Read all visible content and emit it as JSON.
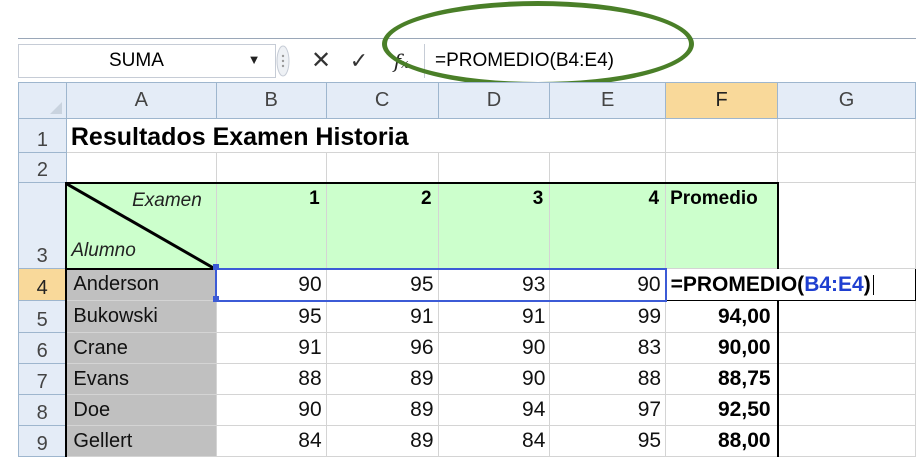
{
  "formula_bar": {
    "name_box": "SUMA",
    "formula": "=PROMEDIO(B4:E4)",
    "fx_label": "fx"
  },
  "columns": [
    "A",
    "B",
    "C",
    "D",
    "E",
    "F",
    "G"
  ],
  "rows": [
    "1",
    "2",
    "3",
    "4",
    "5",
    "6",
    "7",
    "8",
    "9"
  ],
  "sheet": {
    "title": "Resultados Examen Historia",
    "header_top": "Examen",
    "header_bottom": "Alumno",
    "exam_cols": [
      "1",
      "2",
      "3",
      "4"
    ],
    "avg_label": "Promedio",
    "editing": {
      "prefix": "=PROMEDIO(",
      "ref": "B4:E4",
      "suffix": ")"
    },
    "students": [
      {
        "name": "Anderson",
        "scores": [
          "90",
          "95",
          "93",
          "90"
        ],
        "avg": ""
      },
      {
        "name": "Bukowski",
        "scores": [
          "95",
          "91",
          "91",
          "99"
        ],
        "avg": "94,00"
      },
      {
        "name": "Crane",
        "scores": [
          "91",
          "96",
          "90",
          "83"
        ],
        "avg": "90,00"
      },
      {
        "name": "Evans",
        "scores": [
          "88",
          "89",
          "90",
          "88"
        ],
        "avg": "88,75"
      },
      {
        "name": "Doe",
        "scores": [
          "90",
          "89",
          "94",
          "97"
        ],
        "avg": "92,50"
      },
      {
        "name": "Gellert",
        "scores": [
          "84",
          "89",
          "84",
          "95"
        ],
        "avg": "88,00"
      }
    ]
  }
}
